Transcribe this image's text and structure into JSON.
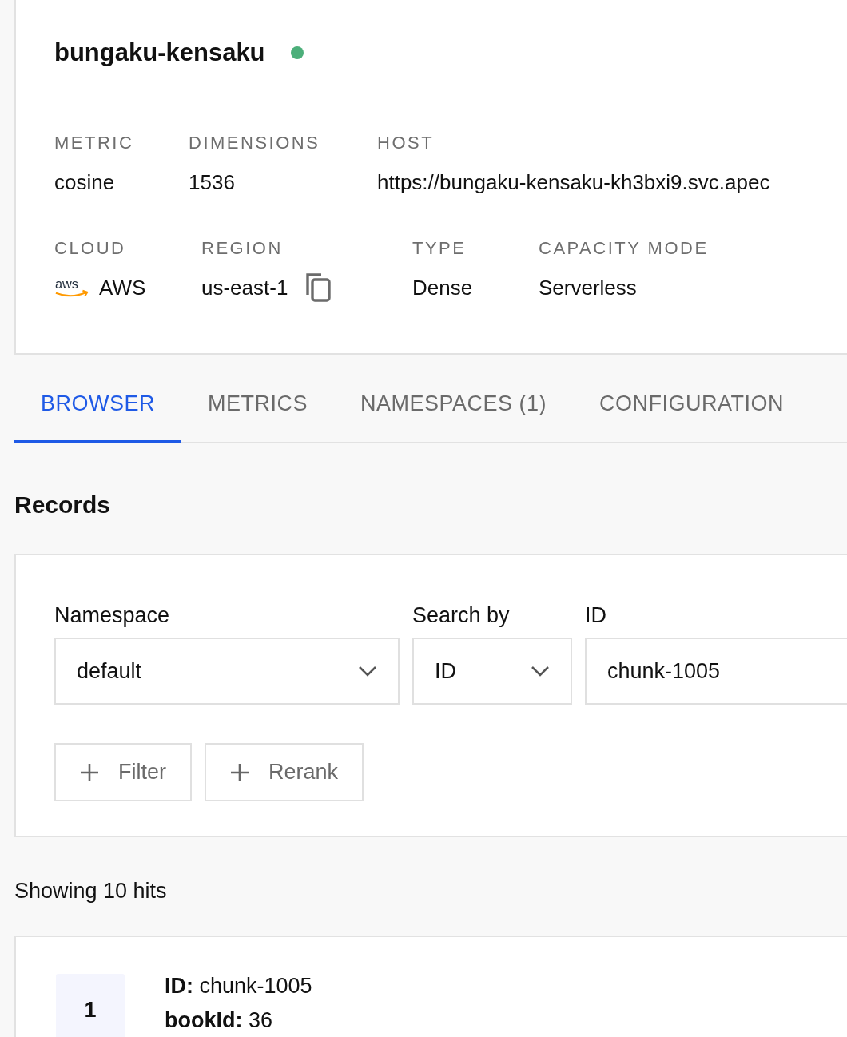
{
  "index": {
    "name": "bungaku-kensaku",
    "online": true,
    "details_rows": [
      [
        {
          "label": "METRIC",
          "value": "cosine",
          "kind": "text"
        },
        {
          "label": "DIMENSIONS",
          "value": "1536",
          "kind": "text"
        },
        {
          "label": "HOST",
          "value": "https://bungaku-kensaku-kh3bxi9.svc.apec",
          "kind": "text"
        }
      ],
      [
        {
          "label": "CLOUD",
          "value": "AWS",
          "kind": "aws",
          "logo": "aws"
        },
        {
          "label": "REGION",
          "value": "us-east-1",
          "kind": "copy"
        },
        {
          "label": "TYPE",
          "value": "Dense",
          "kind": "text"
        },
        {
          "label": "CAPACITY MODE",
          "value": "Serverless",
          "kind": "text"
        }
      ]
    ]
  },
  "tabs": [
    {
      "label": "BROWSER",
      "selected": true
    },
    {
      "label": "METRICS",
      "selected": false
    },
    {
      "label": "NAMESPACES (1)",
      "selected": false
    },
    {
      "label": "CONFIGURATION",
      "selected": false
    }
  ],
  "records": {
    "title": "Records",
    "namespace": {
      "label": "Namespace",
      "value": "default"
    },
    "search_by": {
      "label": "Search by",
      "value": "ID"
    },
    "id_field": {
      "label": "ID",
      "value": "chunk-1005"
    },
    "buttons": [
      "Filter",
      "Rerank"
    ],
    "summary": "Showing 10 hits",
    "hits": [
      {
        "rank": "1",
        "fields": [
          "**ID:** chunk-1005",
          "**bookId:** 36"
        ]
      }
    ]
  }
}
